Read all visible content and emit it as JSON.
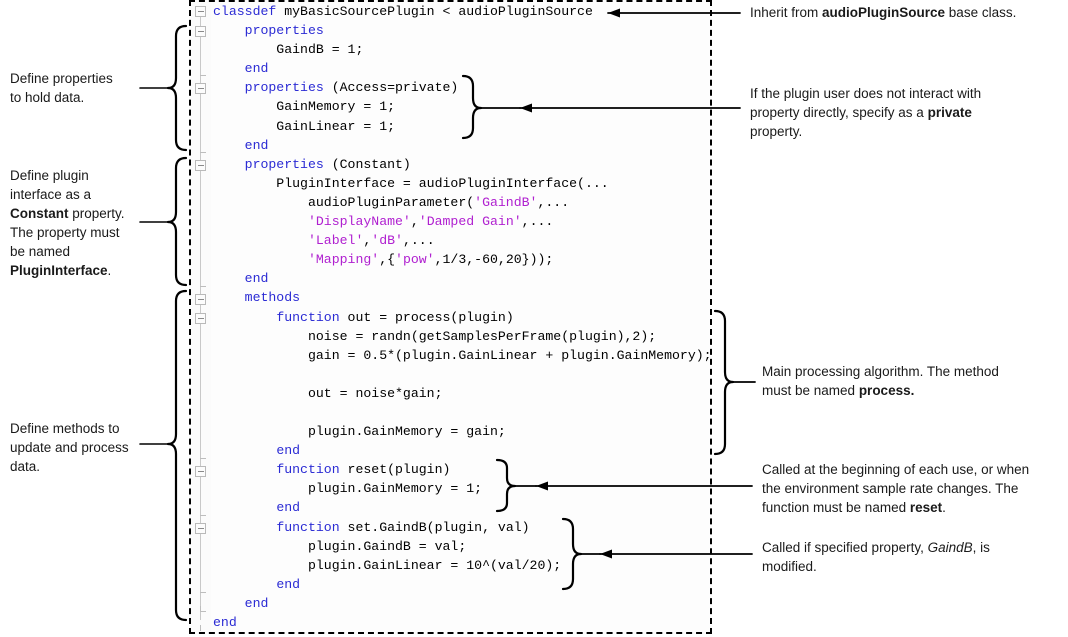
{
  "code": {
    "lines": [
      [
        {
          "t": "classdef ",
          "c": "kw"
        },
        {
          "t": "myBasicSourcePlugin < audioPluginSource",
          "c": "plain"
        }
      ],
      [
        {
          "t": "    ",
          "c": "plain"
        },
        {
          "t": "properties",
          "c": "kw"
        }
      ],
      [
        {
          "t": "        GaindB = 1;",
          "c": "plain"
        }
      ],
      [
        {
          "t": "    ",
          "c": "plain"
        },
        {
          "t": "end",
          "c": "kw"
        }
      ],
      [
        {
          "t": "    ",
          "c": "plain"
        },
        {
          "t": "properties",
          "c": "kw"
        },
        {
          "t": " (Access=private)",
          "c": "plain"
        }
      ],
      [
        {
          "t": "        GainMemory = 1;",
          "c": "plain"
        }
      ],
      [
        {
          "t": "        GainLinear = 1;",
          "c": "plain"
        }
      ],
      [
        {
          "t": "    ",
          "c": "plain"
        },
        {
          "t": "end",
          "c": "kw"
        }
      ],
      [
        {
          "t": "    ",
          "c": "plain"
        },
        {
          "t": "properties",
          "c": "kw"
        },
        {
          "t": " (Constant)",
          "c": "plain"
        }
      ],
      [
        {
          "t": "        PluginInterface = audioPluginInterface(...",
          "c": "plain"
        }
      ],
      [
        {
          "t": "            audioPluginParameter(",
          "c": "plain"
        },
        {
          "t": "'GaindB'",
          "c": "str"
        },
        {
          "t": ",...",
          "c": "plain"
        }
      ],
      [
        {
          "t": "            ",
          "c": "plain"
        },
        {
          "t": "'DisplayName'",
          "c": "str"
        },
        {
          "t": ",",
          "c": "plain"
        },
        {
          "t": "'Damped Gain'",
          "c": "str"
        },
        {
          "t": ",...",
          "c": "plain"
        }
      ],
      [
        {
          "t": "            ",
          "c": "plain"
        },
        {
          "t": "'Label'",
          "c": "str"
        },
        {
          "t": ",",
          "c": "plain"
        },
        {
          "t": "'dB'",
          "c": "str"
        },
        {
          "t": ",...",
          "c": "plain"
        }
      ],
      [
        {
          "t": "            ",
          "c": "plain"
        },
        {
          "t": "'Mapping'",
          "c": "str"
        },
        {
          "t": ",{",
          "c": "plain"
        },
        {
          "t": "'pow'",
          "c": "str"
        },
        {
          "t": ",1/3,-60,20}));",
          "c": "plain"
        }
      ],
      [
        {
          "t": "    ",
          "c": "plain"
        },
        {
          "t": "end",
          "c": "kw"
        }
      ],
      [
        {
          "t": "    ",
          "c": "plain"
        },
        {
          "t": "methods",
          "c": "kw"
        }
      ],
      [
        {
          "t": "        ",
          "c": "plain"
        },
        {
          "t": "function",
          "c": "kw"
        },
        {
          "t": " out = process(plugin)",
          "c": "plain"
        }
      ],
      [
        {
          "t": "            noise = randn(getSamplesPerFrame(plugin),2);",
          "c": "plain"
        }
      ],
      [
        {
          "t": "            gain = 0.5*(plugin.GainLinear + plugin.GainMemory);",
          "c": "plain"
        }
      ],
      [
        {
          "t": "",
          "c": "plain"
        }
      ],
      [
        {
          "t": "            out = noise*gain;",
          "c": "plain"
        }
      ],
      [
        {
          "t": "",
          "c": "plain"
        }
      ],
      [
        {
          "t": "            plugin.GainMemory = gain;",
          "c": "plain"
        }
      ],
      [
        {
          "t": "        ",
          "c": "plain"
        },
        {
          "t": "end",
          "c": "kw"
        }
      ],
      [
        {
          "t": "        ",
          "c": "plain"
        },
        {
          "t": "function",
          "c": "kw"
        },
        {
          "t": " reset(plugin)",
          "c": "plain"
        }
      ],
      [
        {
          "t": "            plugin.GainMemory = 1;",
          "c": "plain"
        }
      ],
      [
        {
          "t": "        ",
          "c": "plain"
        },
        {
          "t": "end",
          "c": "kw"
        }
      ],
      [
        {
          "t": "        ",
          "c": "plain"
        },
        {
          "t": "function",
          "c": "kw"
        },
        {
          "t": " set.GaindB(plugin, val)",
          "c": "plain"
        }
      ],
      [
        {
          "t": "            plugin.GaindB = val;",
          "c": "plain"
        }
      ],
      [
        {
          "t": "            plugin.GainLinear = 10^(val/20);",
          "c": "plain"
        }
      ],
      [
        {
          "t": "        ",
          "c": "plain"
        },
        {
          "t": "end",
          "c": "kw"
        }
      ],
      [
        {
          "t": "    ",
          "c": "plain"
        },
        {
          "t": "end",
          "c": "kw"
        }
      ],
      [
        {
          "t": "",
          "c": "plain"
        },
        {
          "t": "end",
          "c": "kw"
        }
      ]
    ],
    "colors": {
      "keyword": "#2b2bd4",
      "string": "#b020d0",
      "plain": "#000000"
    }
  },
  "annotations": {
    "left": [
      {
        "id": "define-properties",
        "html": "Define properties<br>to hold data."
      },
      {
        "id": "define-plugin-interface",
        "html": "Define plugin<br>interface as a<br><b>Constant</b> property.<br>The property must<br>be named<br><b>PluginInterface</b>."
      },
      {
        "id": "define-methods",
        "html": "Define methods to<br>update and process<br>data."
      }
    ],
    "right": [
      {
        "id": "inherit-base-class",
        "html": "Inherit from <b>audioPluginSource</b> base class."
      },
      {
        "id": "private-property",
        "html": "If the plugin user does not interact with<br>property directly, specify as a <b>private</b><br>property."
      },
      {
        "id": "main-processing-algorithm",
        "html": "Main processing algorithm. The method<br>must be named <b>process.</b>"
      },
      {
        "id": "reset-function",
        "html": "Called at the beginning of each use, or when<br>the environment sample rate changes. The<br>function must be named <b>reset</b>."
      },
      {
        "id": "set-gaindb-function",
        "html": "Called if specified property, <i>GaindB</i>, is<br>modified."
      }
    ]
  }
}
